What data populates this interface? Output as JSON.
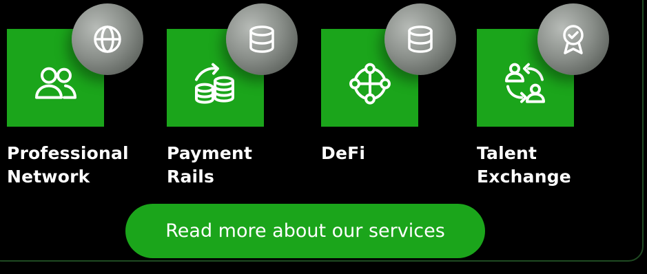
{
  "services": [
    {
      "title_line1": "Professional",
      "title_line2": "Network",
      "tile_icon": "users-icon",
      "badge_icon": "globe-icon"
    },
    {
      "title_line1": "Payment",
      "title_line2": "Rails",
      "tile_icon": "coins-transfer-icon",
      "badge_icon": "database-icon"
    },
    {
      "title_line1": "DeFi",
      "title_line2": "",
      "tile_icon": "network-nodes-icon",
      "badge_icon": "database-icon"
    },
    {
      "title_line1": "Talent",
      "title_line2": "Exchange",
      "tile_icon": "user-exchange-icon",
      "badge_icon": "award-badge-icon"
    }
  ],
  "cta": {
    "label": "Read more about our services"
  },
  "colors": {
    "accent": "#1ba51b",
    "background": "#000000",
    "text": "#ffffff"
  }
}
